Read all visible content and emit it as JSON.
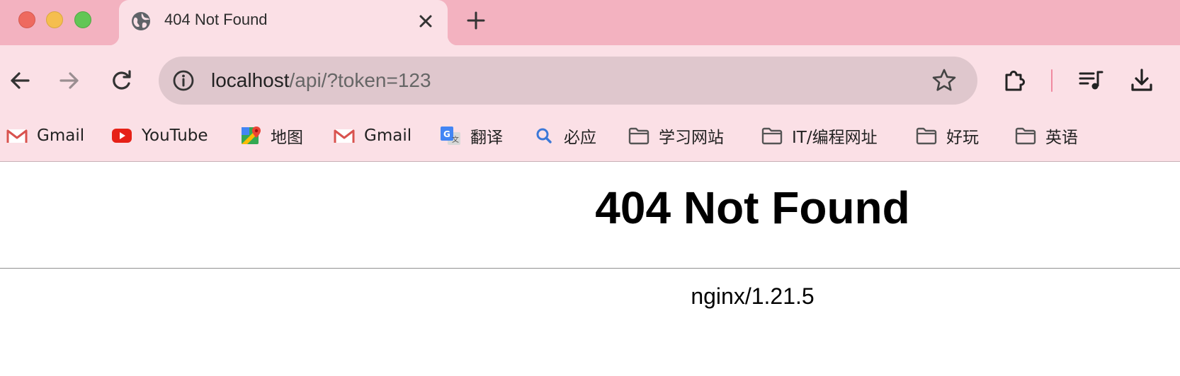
{
  "window": {
    "controls": [
      "close",
      "minimize",
      "maximize"
    ]
  },
  "tab": {
    "title": "404 Not Found",
    "icon": "globe-icon"
  },
  "nav": {
    "back_icon": "back-arrow-icon",
    "forward_icon": "forward-arrow-icon",
    "reload_icon": "reload-icon"
  },
  "omnibox": {
    "host": "localhost",
    "path": "/api/?token=123",
    "info_icon": "info-icon",
    "bookmark_icon": "star-icon"
  },
  "toolbar": {
    "extensions_icon": "puzzle-icon",
    "media_icon": "media-playlist-icon",
    "download_icon": "download-icon"
  },
  "bookmarks": [
    {
      "label": "Gmail",
      "icon": "gmail-icon"
    },
    {
      "label": "YouTube",
      "icon": "youtube-icon"
    },
    {
      "label": "地图",
      "icon": "maps-icon"
    },
    {
      "label": "Gmail",
      "icon": "gmail-icon"
    },
    {
      "label": "翻译",
      "icon": "translate-icon"
    },
    {
      "label": "必应",
      "icon": "search-icon"
    },
    {
      "label": "学习网站",
      "icon": "folder-icon"
    },
    {
      "label": "IT/编程网址",
      "icon": "folder-icon"
    },
    {
      "label": "好玩",
      "icon": "folder-icon"
    },
    {
      "label": "英语",
      "icon": "folder-icon"
    }
  ],
  "page": {
    "heading": "404 Not Found",
    "server": "nginx/1.21.5"
  },
  "colors": {
    "tabbar": "#f3b2c0",
    "toolbar": "#fbe0e6",
    "omnibox": "#dfc7cd"
  }
}
